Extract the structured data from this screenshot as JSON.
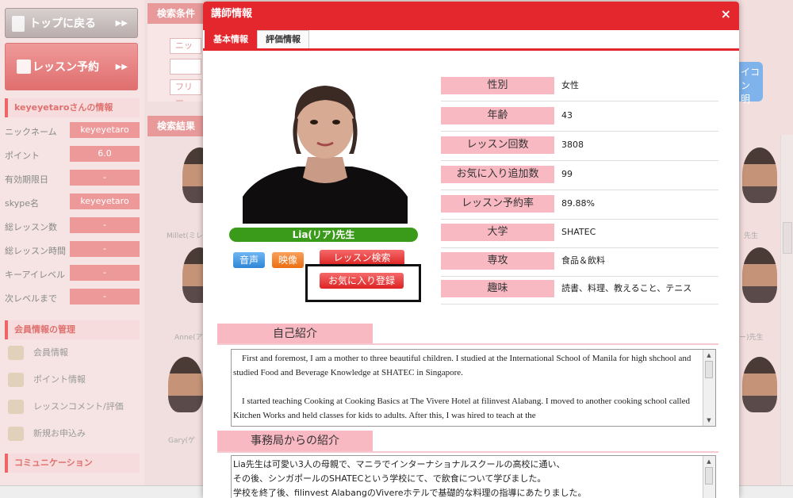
{
  "background": {
    "top_button": "トップに戻る",
    "lesson_button": "レッスン予約",
    "user_info_title": "keyeyetaroさんの情報",
    "user_info": [
      {
        "key": "ニックネーム",
        "value": "keyeyetaro"
      },
      {
        "key": "ポイント",
        "value": "6.0"
      },
      {
        "key": "有効期限日",
        "value": "-"
      },
      {
        "key": "skype名",
        "value": "keyeyetaro"
      },
      {
        "key": "総レッスン数",
        "value": "-"
      },
      {
        "key": "総レッスン時間",
        "value": "-"
      },
      {
        "key": "キーアイレベル",
        "value": "-"
      },
      {
        "key": "次レベルまで",
        "value": "-"
      }
    ],
    "member_mgmt_title": "会員情報の管理",
    "member_items": [
      "会員情報",
      "ポイント情報",
      "レッスンコメント/評価",
      "新規お申込み"
    ],
    "communication_title": "コミュニケーション",
    "search_conditions": "検索条件",
    "search_fields": [
      "ニッ",
      "",
      "フリー"
    ],
    "search_results": "検索結果",
    "thumb_labels": [
      "Millet(ミレ",
      "Anne(アン",
      "Gary(ゲ",
      "ー)先生",
      "先生"
    ],
    "right_button": "イコン 明"
  },
  "modal": {
    "title": "講師情報",
    "close_label": "×",
    "tabs": [
      "基本情報",
      "評価情報"
    ],
    "teacher_name": "Lia(リア)先生",
    "buttons": {
      "voice": "音声",
      "video": "映像",
      "lesson_search": "レッスン検索",
      "favorite": "お気に入り登録"
    },
    "attributes": [
      {
        "key": "性別",
        "value": "女性"
      },
      {
        "key": "年齢",
        "value": "43"
      },
      {
        "key": "レッスン回数",
        "value": "3808"
      },
      {
        "key": "お気に入り追加数",
        "value": "99"
      },
      {
        "key": "レッスン予約率",
        "value": "89.88%"
      },
      {
        "key": "大学",
        "value": "SHATEC"
      },
      {
        "key": "専攻",
        "value": "食品＆飲料"
      },
      {
        "key": "趣味",
        "value": "読書、料理、教えること、テニス"
      }
    ],
    "self_intro_title": "自己紹介",
    "self_intro_text": "    First and foremost, I am a mother to three beautiful children. I studied at the International School of Manila for high shchool and studied Food and Beverage Knowledge at SHATEC in Singapore.\n\n    I started teaching Cooking at Cooking Basics at The Vivere Hotel at filinvest Alabang. I moved to another cooking school called Kitchen Works and held classes for kids to adults. After this, I was hired to teach at the",
    "office_intro_title": "事務局からの紹介",
    "office_intro_text": "Lia先生は可愛い3人の母親で、マニラでインターナショナルスクールの高校に通い、\nその後、シンガポールのSHATECという学校にて、で飲食について学びました。\n学校を終了後、filinvest AlabangのVivereホテルで基礎的な料理の指導にあたりました。"
  }
}
